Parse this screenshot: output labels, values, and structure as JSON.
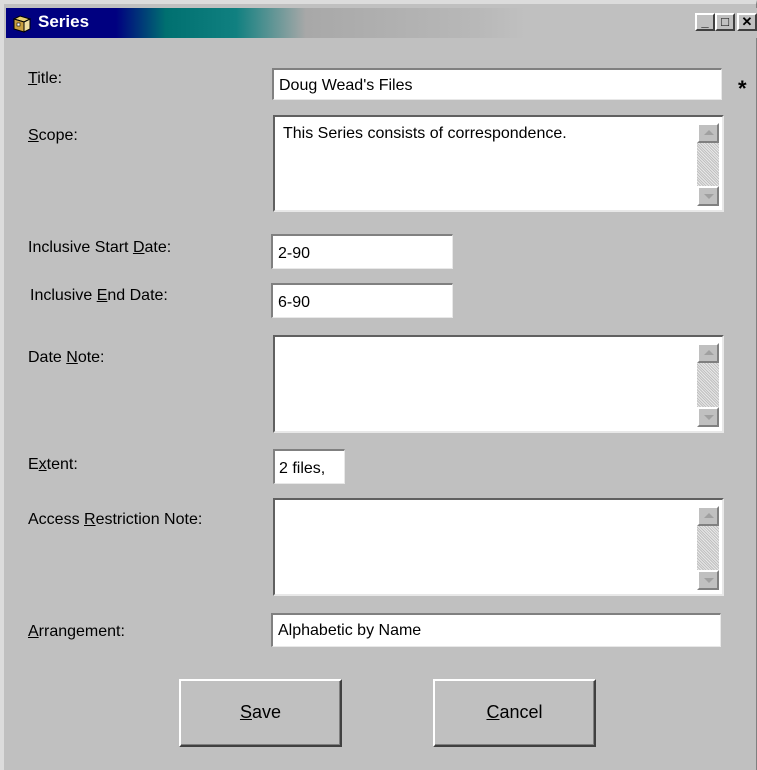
{
  "window": {
    "title": "Series",
    "icon": "folder-box-icon",
    "controls": {
      "minimize": "_",
      "maximize": "□",
      "close": "✕"
    }
  },
  "form": {
    "title": {
      "label_pre": "",
      "label_key": "T",
      "label_post": "itle:",
      "value": "Doug Wead's Files",
      "required_marker": "*"
    },
    "scope": {
      "label_pre": "",
      "label_key": "S",
      "label_post": "cope:",
      "value": "This Series consists of correspondence."
    },
    "start_date": {
      "label_pre": "Inclusive Start ",
      "label_key": "D",
      "label_post": "ate:",
      "value": "2-90"
    },
    "end_date": {
      "label_pre": "Inclusive ",
      "label_key": "E",
      "label_post": "nd Date:",
      "value": "6-90"
    },
    "date_note": {
      "label_pre": "Date ",
      "label_key": "N",
      "label_post": "ote:",
      "value": ""
    },
    "extent": {
      "label_pre": "E",
      "label_key": "x",
      "label_post": "tent:",
      "value": "2 files,"
    },
    "access_note": {
      "label_pre": "Access ",
      "label_key": "R",
      "label_post": "estriction Note:",
      "value": ""
    },
    "arrangement": {
      "label_pre": "",
      "label_key": "A",
      "label_post": "rrangement:",
      "value": "Alphabetic by Name"
    }
  },
  "buttons": {
    "save": {
      "key": "S",
      "rest": "ave"
    },
    "cancel": {
      "key": "C",
      "rest": "ancel"
    }
  }
}
